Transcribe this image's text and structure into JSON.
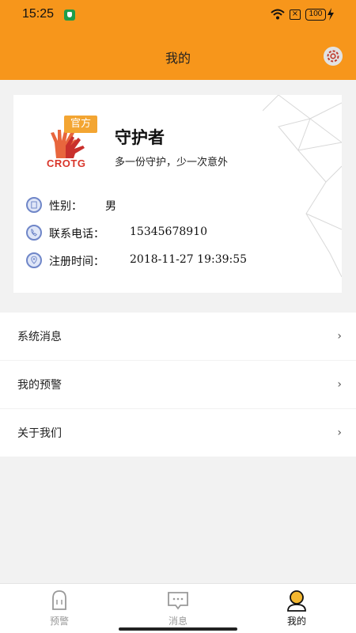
{
  "status_bar": {
    "time": "15:25",
    "battery": "100"
  },
  "header": {
    "title": "我的"
  },
  "profile": {
    "logo_badge": "官方",
    "logo_brand": "CROTG",
    "name": "守护者",
    "slogan": "多一份守护，少一次意外",
    "gender_label": "性别：",
    "gender_value": "男",
    "phone_label": "联系电话：",
    "phone_value": "15345678910",
    "register_label": "注册时间：",
    "register_value": "2018-11-27 19:39:55"
  },
  "menu": {
    "items": [
      {
        "label": "系统消息"
      },
      {
        "label": "我的预警"
      },
      {
        "label": "关于我们"
      }
    ]
  },
  "tabs": [
    {
      "label": "预警",
      "icon": "bell-icon"
    },
    {
      "label": "消息",
      "icon": "message-icon"
    },
    {
      "label": "我的",
      "icon": "user-icon"
    }
  ],
  "colors": {
    "accent": "#f7961b",
    "tab_inactive": "#999999",
    "tab_active": "#111111"
  }
}
